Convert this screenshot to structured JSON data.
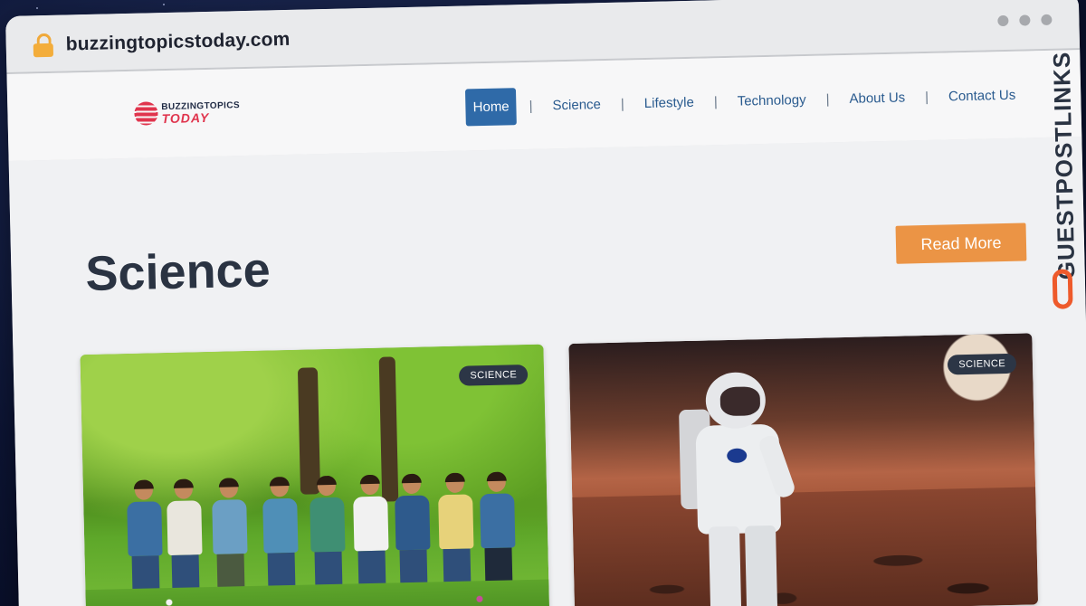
{
  "browser": {
    "url": "buzzingtopicstoday.com",
    "lock_icon": "lock-icon",
    "window_controls": [
      "dot",
      "dot",
      "dot"
    ]
  },
  "site": {
    "logo_line1": "BUZZINGTOPICS",
    "logo_line2": "TODAY",
    "nav": [
      {
        "label": "Home",
        "active": true
      },
      {
        "label": "Science",
        "active": false
      },
      {
        "label": "Lifestyle",
        "active": false
      },
      {
        "label": "Technology",
        "active": false
      },
      {
        "label": "About Us",
        "active": false
      },
      {
        "label": "Contact Us",
        "active": false
      }
    ],
    "nav_separator": "|"
  },
  "main": {
    "title": "Science",
    "read_more": "Read More",
    "cards": [
      {
        "badge": "SCIENCE",
        "image": "group-of-volunteers-in-park"
      },
      {
        "badge": "SCIENCE",
        "image": "astronaut-on-mars"
      }
    ]
  },
  "watermark": {
    "text": "GUESTPOSTLINKS",
    "icon": "chain-link-icon"
  },
  "colors": {
    "nav_active": "#2f6aa8",
    "nav_text": "#2a5b8f",
    "read_more": "#eb9445",
    "logo_red": "#e0344d",
    "badge_bg": "#2c3646",
    "watermark_icon": "#ee5a2b"
  }
}
